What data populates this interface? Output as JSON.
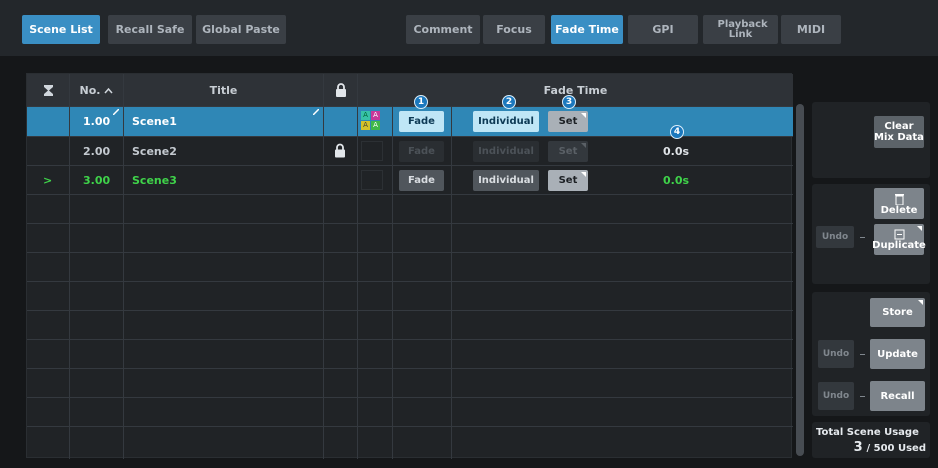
{
  "tabs_left": [
    {
      "label": "Scene List",
      "active": true
    },
    {
      "label": "Recall Safe",
      "active": false
    },
    {
      "label": "Global Paste",
      "active": false
    }
  ],
  "tabs_right": [
    {
      "label": "Comment",
      "active": false
    },
    {
      "label": "Focus",
      "active": false
    },
    {
      "label": "Fade Time",
      "active": true
    },
    {
      "label": "GPI",
      "active": false
    },
    {
      "label": "Playback Link",
      "active": false
    },
    {
      "label": "MIDI",
      "active": false
    }
  ],
  "table": {
    "col_number": "No.",
    "col_title": "Title",
    "col_fade_time": "Fade Time",
    "sort_icon": "hourglass-icon",
    "lock_icon": "lock-icon",
    "rows": [
      {
        "number": "1.00",
        "title": "Scene1",
        "fade": "Fade",
        "individual": "Individual",
        "set": "Set",
        "time": "",
        "locked": false,
        "selected": true,
        "current": false
      },
      {
        "number": "2.00",
        "title": "Scene2",
        "fade": "Fade",
        "individual": "Individual",
        "set": "Set",
        "time": "0.0s",
        "locked": true,
        "selected": false,
        "current": false
      },
      {
        "number": "3.00",
        "title": "Scene3",
        "fade": "Fade",
        "individual": "Individual",
        "set": "Set",
        "time": "0.0s",
        "locked": false,
        "selected": false,
        "current": true
      }
    ],
    "current_marker": ">"
  },
  "callouts": [
    "1",
    "2",
    "3",
    "4"
  ],
  "focus_flags": [
    "A",
    "A",
    "A",
    "A"
  ],
  "right_panel": {
    "clear_mix_data": "Clear Mix Data",
    "undo": "Undo",
    "delete": "Delete",
    "duplicate": "Duplicate",
    "store": "Store",
    "update": "Update",
    "recall": "Recall",
    "usage_label": "Total Scene Usage",
    "usage_count": "3",
    "usage_total": "/ 500 Used"
  },
  "colors": {
    "accent": "#3a8fc4",
    "selected_row": "#2f87b6",
    "current_scene": "#3fd34a"
  }
}
